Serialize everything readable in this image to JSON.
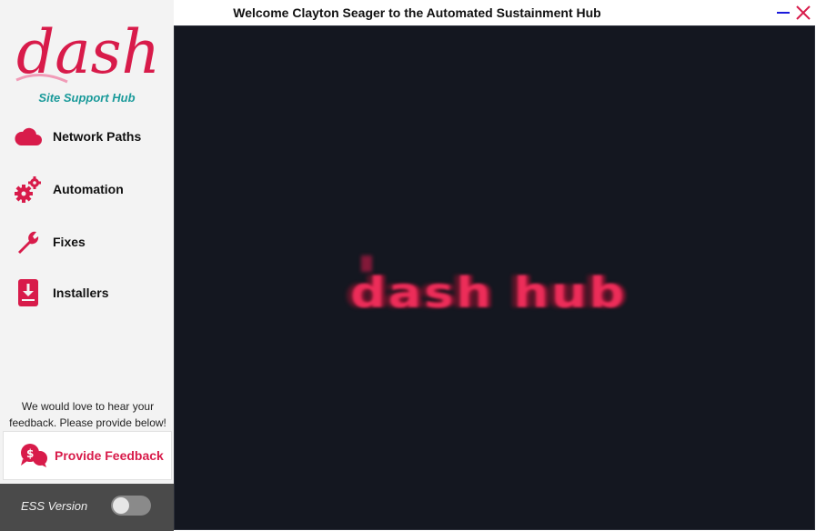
{
  "window": {
    "title": "Welcome Clayton Seager to the Automated Sustainment Hub",
    "minimize_icon": "minimize-icon",
    "close_icon": "close-icon"
  },
  "sidebar": {
    "logo_text": "dash",
    "subtitle": "Site Support Hub",
    "items": [
      {
        "label": "Network Paths",
        "icon": "cloud-icon"
      },
      {
        "label": "Automation",
        "icon": "gears-icon"
      },
      {
        "label": "Fixes",
        "icon": "wrench-icon"
      },
      {
        "label": "Installers",
        "icon": "download-icon"
      }
    ],
    "feedback_prompt_line1": "We would love to hear your",
    "feedback_prompt_line2": "feedback. Please provide below!",
    "feedback_button": {
      "label": "Provide Feedback",
      "icon": "feedback-chat-icon"
    },
    "footer": {
      "label": "ESS Version",
      "toggle_on": false
    }
  },
  "main": {
    "splash_text": "dash hub"
  },
  "colors": {
    "accent": "#d81b4a",
    "subtitle": "#1a9a9a",
    "sidebar_bg": "#f3f3f3",
    "footer_bg": "#4a4a4a",
    "main_bg": "#141720",
    "minimize": "#1a1adb",
    "close": "#d81b4a"
  }
}
